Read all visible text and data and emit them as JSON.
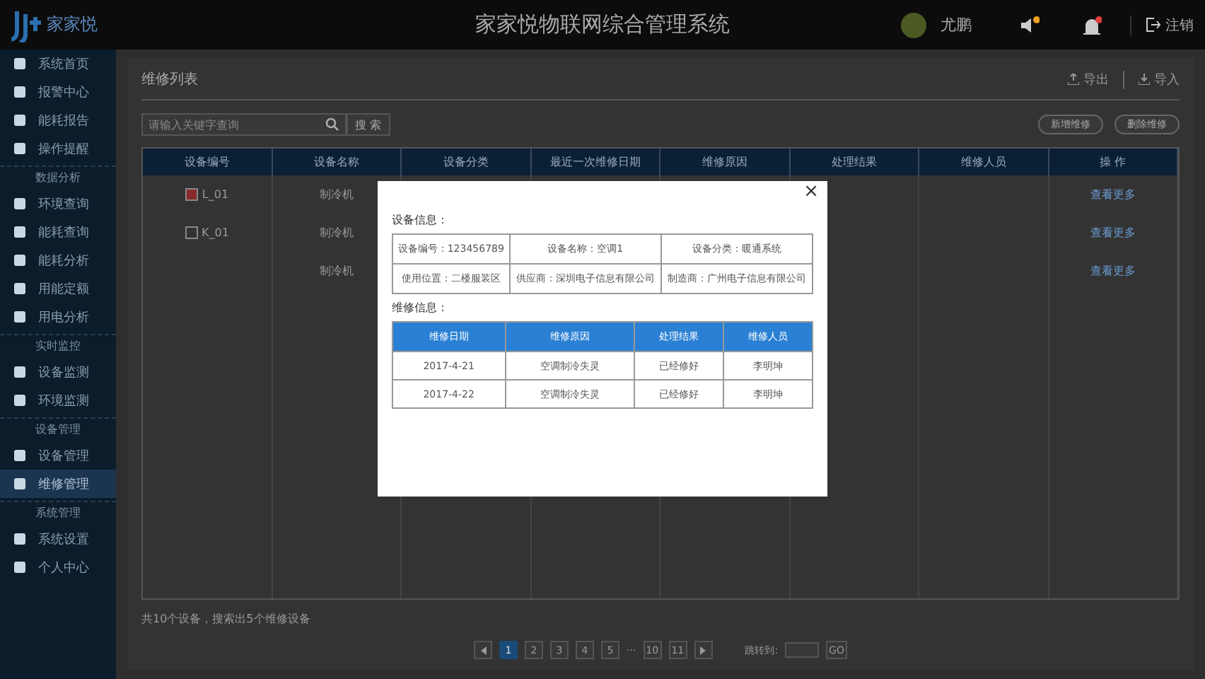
{
  "header": {
    "logo": "家家悦",
    "title": "家家悦物联网综合管理系统",
    "user": "尤鹏",
    "logout": "注销"
  },
  "sidebar": {
    "items": [
      {
        "kind": "item",
        "label": "系统首页",
        "selected": false
      },
      {
        "kind": "item",
        "label": "报警中心",
        "selected": false
      },
      {
        "kind": "item",
        "label": "能耗报告",
        "selected": false
      },
      {
        "kind": "item",
        "label": "操作提醒",
        "selected": false
      },
      {
        "kind": "section",
        "label": "数据分析"
      },
      {
        "kind": "item",
        "label": "环境查询",
        "selected": false
      },
      {
        "kind": "item",
        "label": "能耗查询",
        "selected": false
      },
      {
        "kind": "item",
        "label": "能耗分析",
        "selected": false
      },
      {
        "kind": "item",
        "label": "用能定额",
        "selected": false
      },
      {
        "kind": "item",
        "label": "用电分析",
        "selected": false
      },
      {
        "kind": "section",
        "label": "实时监控"
      },
      {
        "kind": "item",
        "label": "设备监测",
        "selected": false
      },
      {
        "kind": "item",
        "label": "环境监测",
        "selected": false
      },
      {
        "kind": "section",
        "label": "设备管理"
      },
      {
        "kind": "item",
        "label": "设备管理",
        "selected": false
      },
      {
        "kind": "item",
        "label": "维修管理",
        "selected": true
      },
      {
        "kind": "section",
        "label": "系统管理"
      },
      {
        "kind": "item",
        "label": "系统设置",
        "selected": false
      },
      {
        "kind": "item",
        "label": "个人中心",
        "selected": false
      }
    ]
  },
  "panel": {
    "title": "维修列表",
    "export": "导出",
    "import": "导入",
    "search": {
      "placeholder": "请输入关键字查询",
      "button": "搜 索"
    },
    "buttons": [
      "新增维修",
      "删除维修"
    ],
    "table": {
      "columns": [
        "设备编号",
        "设备名称",
        "设备分类",
        "最近一次维修日期",
        "维修原因",
        "处理结果",
        "维修人员",
        "操 作"
      ],
      "rows": [
        {
          "id": "L_01",
          "checked": true,
          "name": "制冷机",
          "action": "查看更多"
        },
        {
          "id": "K_01",
          "checked": false,
          "name": "制冷机",
          "action": "查看更多"
        },
        {
          "name": "制冷机",
          "action": "查看更多"
        }
      ]
    },
    "summary": "共10个设备，搜索出5个维修设备",
    "pagination": {
      "pages": [
        {
          "label": "1",
          "selected": true
        },
        {
          "label": "2",
          "selected": false
        },
        {
          "label": "3",
          "selected": false
        },
        {
          "label": "4",
          "selected": false
        },
        {
          "label": "5",
          "selected": false
        },
        {
          "label": "···",
          "kind": "gap"
        },
        {
          "label": "10",
          "selected": false
        },
        {
          "label": "11",
          "selected": false
        }
      ],
      "jump_label": "跳转到:",
      "go": "GO"
    }
  },
  "modal": {
    "close": "×",
    "device_title": "设备信息：",
    "device_info": [
      [
        "设备编号：123456789",
        "设备名称：空调1",
        "设备分类：暖通系统"
      ],
      [
        "使用位置：二楼服装区",
        "供应商：深圳电子信息有限公司",
        "制造商：广州电子信息有限公司"
      ]
    ],
    "repair_title": "维修信息：",
    "repair_columns": [
      "维修日期",
      "维修原因",
      "处理结果",
      "维修人员"
    ],
    "repair_rows": [
      [
        "2017-4-21",
        "空调制冷失灵",
        "已经修好",
        "李明坤"
      ],
      [
        "2017-4-22",
        "空调制冷失灵",
        "已经修好",
        "李明坤"
      ]
    ]
  }
}
